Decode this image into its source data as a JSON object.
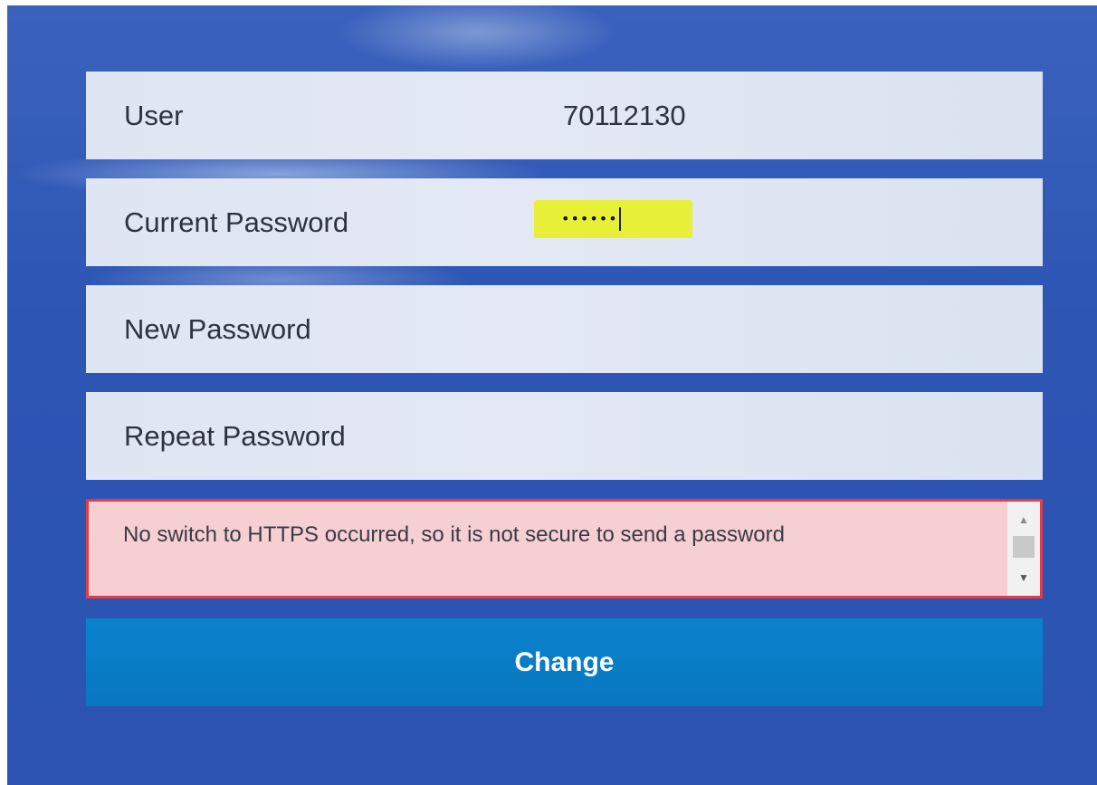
{
  "form": {
    "user": {
      "label": "User",
      "value": "70112130"
    },
    "current_password": {
      "label": "Current Password",
      "masked_value": "••••••"
    },
    "new_password": {
      "label": "New Password"
    },
    "repeat_password": {
      "label": "Repeat Password"
    },
    "error": {
      "message": "No switch to HTTPS occurred, so it is not secure to send a password"
    },
    "change_label": "Change"
  },
  "colors": {
    "panel_bg": "#2d55b4",
    "field_bg": "#e0e6f3",
    "highlight": "#e8ef38",
    "error_bg": "#f6cfd3",
    "error_border": "#e23c47",
    "button_bg": "#0a7dc7"
  },
  "icons": {
    "scroll_up": "arrow-up-icon",
    "scroll_down": "arrow-down-icon"
  }
}
